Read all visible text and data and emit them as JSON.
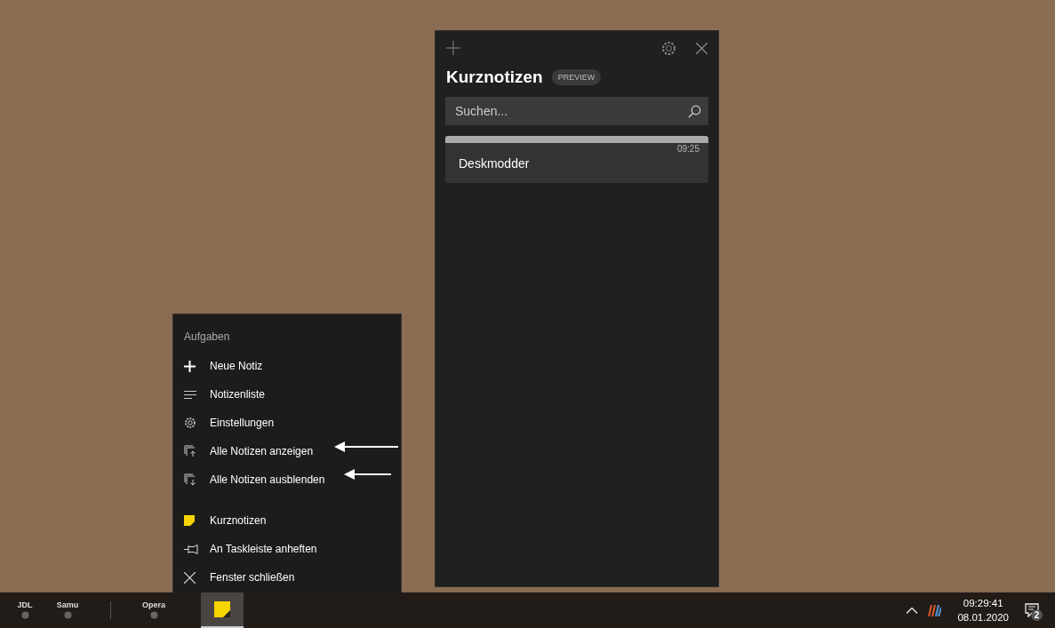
{
  "notes_window": {
    "title": "Kurznotizen",
    "badge": "PREVIEW",
    "search": {
      "placeholder": "Suchen..."
    },
    "notes": [
      {
        "time": "09:25",
        "text": "Deskmodder"
      }
    ]
  },
  "jump_list": {
    "heading": "Aufgaben",
    "tasks": [
      {
        "kind": "new",
        "label": "Neue Notiz"
      },
      {
        "kind": "list",
        "label": "Notizenliste"
      },
      {
        "kind": "settings",
        "label": "Einstellungen"
      },
      {
        "kind": "show",
        "label": "Alle Notizen anzeigen"
      },
      {
        "kind": "hide",
        "label": "Alle Notizen ausblenden"
      }
    ],
    "items": [
      {
        "kind": "app",
        "label": "Kurznotizen"
      },
      {
        "kind": "pin",
        "label": "An Taskleiste anheften"
      },
      {
        "kind": "close",
        "label": "Fenster schließen"
      }
    ]
  },
  "taskbar": {
    "items": [
      {
        "kind": "labeled",
        "label": "JDL",
        "selected": false
      },
      {
        "kind": "labeled",
        "label": "Samu",
        "selected": false
      },
      {
        "kind": "separator"
      },
      {
        "kind": "labeled",
        "label": "Opera",
        "selected": false
      },
      {
        "kind": "sticky",
        "selected": true
      }
    ],
    "clock": {
      "time": "09:29:41",
      "date": "08.01.2020"
    },
    "notification_count": "2"
  }
}
